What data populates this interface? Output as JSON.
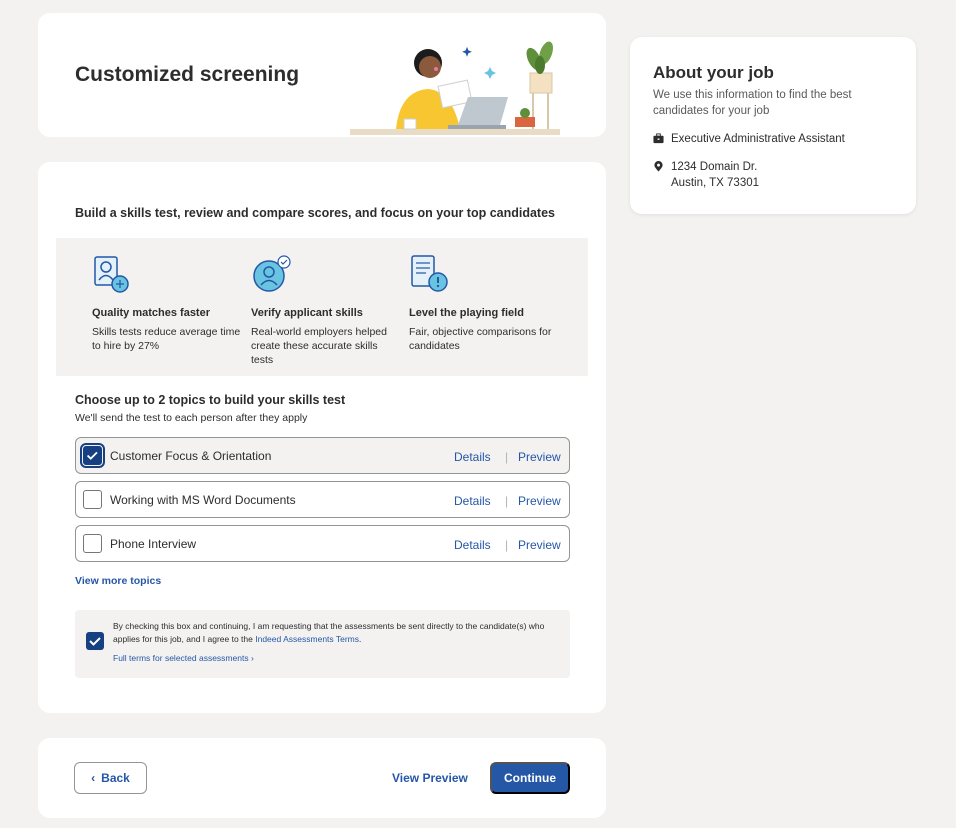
{
  "header": {
    "title": "Customized screening"
  },
  "main": {
    "intro": "Build a skills test, review and compare scores, and focus on your top candidates",
    "benefits": [
      {
        "icon": "person-badge-icon",
        "title": "Quality matches faster",
        "text": "Skills tests reduce average time to hire by 27%"
      },
      {
        "icon": "verified-person-icon",
        "title": "Verify applicant skills",
        "text": "Real-world employers helped create these accurate skills tests"
      },
      {
        "icon": "document-alert-icon",
        "title": "Level the playing field",
        "text": "Fair, objective comparisons for candidates"
      }
    ],
    "topics_title": "Choose up to 2 topics to build your skills test",
    "topics_subtitle": "We'll send the test to each person after they apply",
    "topics": [
      {
        "label": "Customer Focus & Orientation",
        "checked": true,
        "details": "Details",
        "preview": "Preview"
      },
      {
        "label": "Working with MS Word Documents",
        "checked": false,
        "details": "Details",
        "preview": "Preview"
      },
      {
        "label": "Phone Interview",
        "checked": false,
        "details": "Details",
        "preview": "Preview"
      }
    ],
    "separator": "|",
    "view_more": "View more topics",
    "consent": {
      "checked": true,
      "text_before": "By checking this box and continuing, I am requesting that the assessments be sent directly to the candidate(s) who applies for this job, and I agree to the ",
      "link": "Indeed Assessments Terms",
      "text_after": ".",
      "full_terms": "Full terms for selected assessments"
    }
  },
  "footer": {
    "back_label": "Back",
    "view_preview_label": "View Preview",
    "continue_label": "Continue"
  },
  "sidebar": {
    "title": "About your job",
    "subtitle": "We use this information to find the best candidates for your job",
    "job_title": "Executive Administrative Assistant",
    "address_line1": "1234 Domain Dr.",
    "address_line2": "Austin, TX 73301"
  },
  "colors": {
    "accent": "#2557a7",
    "checkbox": "#164081",
    "background": "#f3f2f1"
  }
}
